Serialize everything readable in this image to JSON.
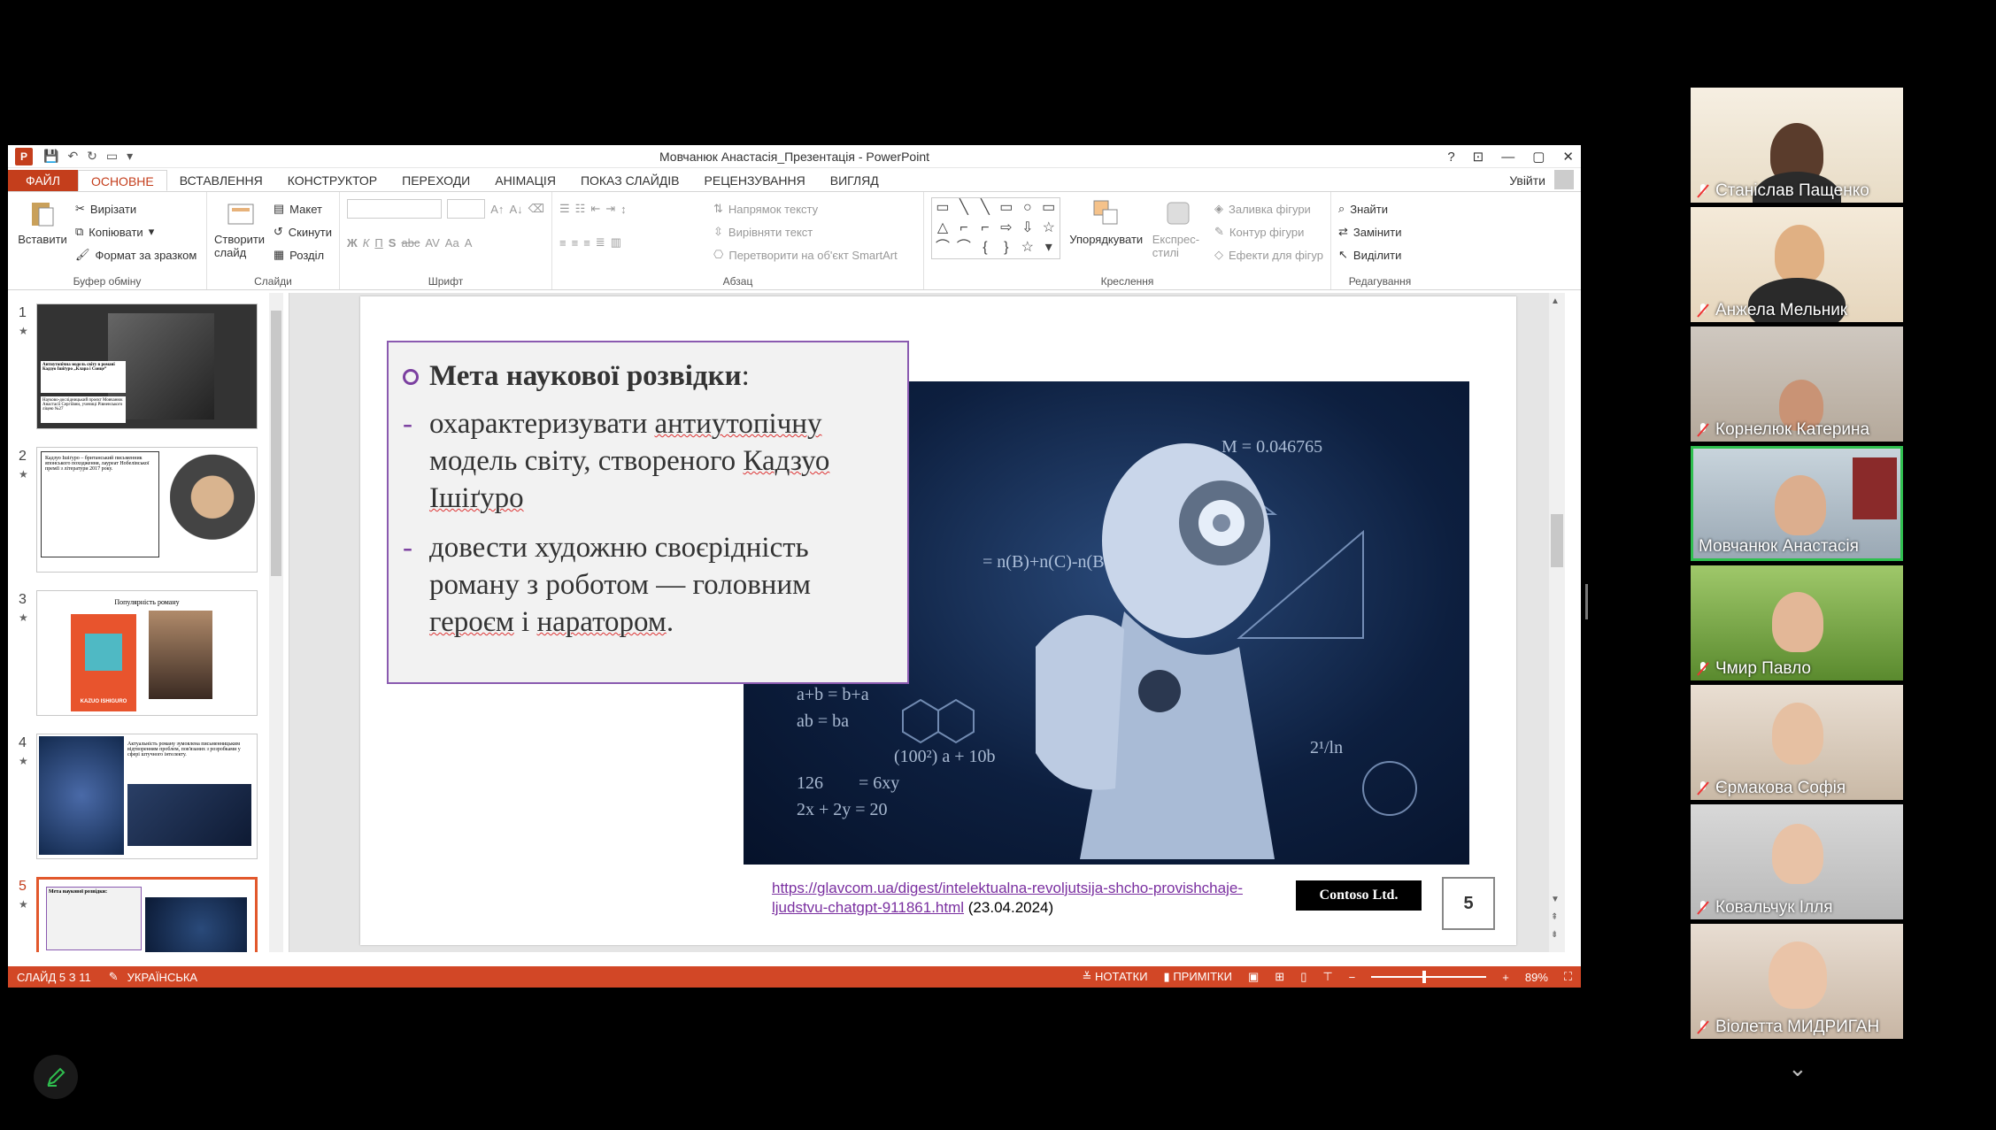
{
  "window": {
    "title": "Мовчанюк Анастасія_Презентація - PowerPoint",
    "help": "?",
    "controls": [
      "—",
      "▢",
      "✕"
    ]
  },
  "tabs": [
    "ФАЙЛ",
    "ОСНОВНЕ",
    "ВСТАВЛЕННЯ",
    "КОНСТРУКТОР",
    "ПЕРЕХОДИ",
    "АНІМАЦІЯ",
    "ПОКАЗ СЛАЙДІВ",
    "РЕЦЕНЗУВАННЯ",
    "ВИГЛЯД"
  ],
  "signin": "Увійти",
  "ribbon": {
    "clipboard": {
      "paste": "Вставити",
      "cut": "Вирізати",
      "copy": "Копіювати",
      "format": "Формат за зразком",
      "label": "Буфер обміну"
    },
    "slides": {
      "new": "Створити слайд",
      "layout": "Макет",
      "reset": "Скинути",
      "section": "Розділ",
      "label": "Слайди"
    },
    "font": {
      "label": "Шрифт",
      "bold": "Ж",
      "italic": "К",
      "underline": "П",
      "shadow": "S",
      "strike": "abc",
      "spacing": "AV",
      "case": "Aa",
      "color": "A"
    },
    "paragraph": {
      "direction": "Напрямок тексту",
      "align": "Вирівняти текст",
      "smartart": "Перетворити на об'єкт SmartArt",
      "label": "Абзац"
    },
    "drawing": {
      "arrange": "Упорядкувати",
      "styles": "Експрес-стилі",
      "fill": "Заливка фігури",
      "outline": "Контур фігури",
      "effects": "Ефекти для фігур",
      "label": "Креслення"
    },
    "editing": {
      "find": "Знайти",
      "replace": "Замінити",
      "select": "Виділити",
      "label": "Редагування"
    }
  },
  "thumbnails": {
    "items": [
      {
        "num": "1",
        "title": "Антиутопічна модель світу в романі Кадзуо Ішіґуро „Клара і Сонце”",
        "sub": "Науково-дослідницький проєкт Мовчанюк Анастасії Сергіївни, учениці Рівненського ліцею №27"
      },
      {
        "num": "2",
        "title": "Кадзуо Ішіґуро – британський письменник японського походження, лауреат Нобелівської премії з літератури 2017 року."
      },
      {
        "num": "3",
        "title": "Популярність роману",
        "sub": "KAZUO ISHIGURO"
      },
      {
        "num": "4",
        "title": "Актуальність роману зумовлена письменницьким відтворенням проблем, пов'язаних з розробками у сфері штучного інтелекту."
      },
      {
        "num": "5",
        "title": "Мета наукової розвідки:"
      }
    ]
  },
  "slide": {
    "heading": "Мета наукової розвідки",
    "colon": ":",
    "items": [
      {
        "before": "охарактеризувати ",
        "u1": "антиутопічну",
        "mid": " модель світу, створеного ",
        "u2": "Кадзуо",
        "after": "",
        "u3": "Ішіґуро",
        "end": ""
      },
      {
        "before": "довести художню своєрідність роману  з роботом — головним ",
        "u1": "героєм",
        "mid": " і ",
        "u2": "наратором",
        "after": "."
      }
    ],
    "link": "https://glavcom.ua/digest/intelektualna-revoljutsija-shcho-provishchaje-ljudstvu-chatgpt-911861.html",
    "date": " (23.04.2024)",
    "logo": "Contoso Ltd.",
    "number": "5"
  },
  "statusbar": {
    "slide": "СЛАЙД 5 З 11",
    "lang": "УКРАЇНСЬКА",
    "notes": "НОТАТКИ",
    "comments": "ПРИМІТКИ",
    "zoom": "89%"
  },
  "participants": [
    {
      "name": "Станіслав Пащенко"
    },
    {
      "name": "Анжела Мельник"
    },
    {
      "name": "Корнелюк Катерина"
    },
    {
      "name": "Мовчанюк Анастасія"
    },
    {
      "name": "Чмир Павло"
    },
    {
      "name": "Єрмакова Софія"
    },
    {
      "name": "Ковальчук Ілля"
    },
    {
      "name": "Віолетта МИДРИГАН"
    }
  ],
  "colors": {
    "accent": "#c43e1c",
    "status": "#d24726",
    "active_tile": "#2fbf4f",
    "slide_border": "#8a5ab0"
  }
}
